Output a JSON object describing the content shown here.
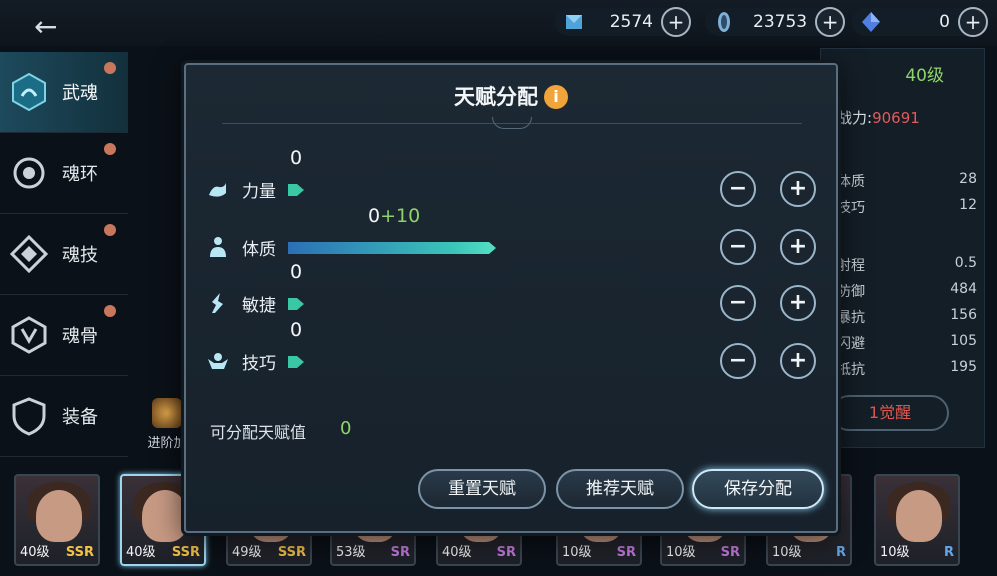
{
  "resources": [
    {
      "icon": "crystal-icon",
      "value": "2574"
    },
    {
      "icon": "soul-coin-icon",
      "value": "23753"
    },
    {
      "icon": "blue-gem-icon",
      "value": "0"
    }
  ],
  "sidebar": {
    "items": [
      {
        "label": "武魂",
        "icon": "martial-soul-icon"
      },
      {
        "label": "魂环",
        "icon": "soul-ring-icon"
      },
      {
        "label": "魂技",
        "icon": "soul-skill-icon"
      },
      {
        "label": "魂骨",
        "icon": "soul-bone-icon"
      },
      {
        "label": "装备",
        "icon": "equipment-icon"
      }
    ]
  },
  "advance": {
    "label": "进阶加"
  },
  "right_panel": {
    "level": "40级",
    "power_label": "战力:",
    "power_value": "90691",
    "stats": [
      {
        "name": "体质",
        "value": "28"
      },
      {
        "name": "技巧",
        "value": "12"
      },
      {
        "name": "射程",
        "value": "0.5"
      },
      {
        "name": "防御",
        "value": "484"
      },
      {
        "name": "暴抗",
        "value": "156"
      },
      {
        "name": "闪避",
        "value": "105"
      },
      {
        "name": "抵抗",
        "value": "195"
      }
    ],
    "awaken_label": "1觉醒"
  },
  "characters": [
    {
      "level": "40级",
      "rarity": "SSR"
    },
    {
      "level": "40级",
      "rarity": "SSR"
    },
    {
      "level": "49级",
      "rarity": "SSR"
    },
    {
      "level": "53级",
      "rarity": "SR"
    },
    {
      "level": "40级",
      "rarity": "SR"
    },
    {
      "level": "10级",
      "rarity": "SR"
    },
    {
      "level": "10级",
      "rarity": "SR"
    },
    {
      "level": "10级",
      "rarity": "R"
    },
    {
      "level": "10级",
      "rarity": "R"
    }
  ],
  "modal": {
    "title": "天赋分配",
    "attributes": [
      {
        "name": "力量",
        "value": "0",
        "bonus": "",
        "icon": "strength-icon",
        "fill": 0
      },
      {
        "name": "体质",
        "value": "0",
        "bonus": "+10",
        "icon": "constitution-icon",
        "fill": 1
      },
      {
        "name": "敏捷",
        "value": "0",
        "bonus": "",
        "icon": "agility-icon",
        "fill": 0
      },
      {
        "name": "技巧",
        "value": "0",
        "bonus": "",
        "icon": "technique-icon",
        "fill": 0
      }
    ],
    "points_label": "可分配天赋值",
    "points_value": "0",
    "buttons": {
      "reset": "重置天赋",
      "recommend": "推荐天赋",
      "save": "保存分配"
    },
    "minus": "−",
    "plus": "+"
  },
  "colors": {
    "accent_green": "#8fd36a",
    "bar_teal": "#3ac7a3",
    "info_orange": "#f1a43a",
    "power_red": "#e35a5a"
  }
}
